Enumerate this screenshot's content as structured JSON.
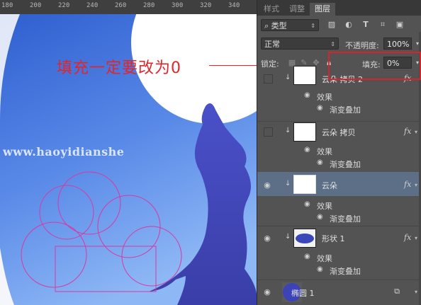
{
  "ruler": {
    "labels": [
      "180",
      "200",
      "220",
      "240",
      "260",
      "280",
      "300",
      "320",
      "340"
    ]
  },
  "canvas": {
    "watermark": "www.haoyidianshe",
    "annotation": "填充一定要改为0"
  },
  "panel": {
    "tabs": [
      {
        "label": "样式",
        "active": false
      },
      {
        "label": "调整",
        "active": false
      },
      {
        "label": "图层",
        "active": true
      }
    ],
    "filter": {
      "kind_label": "类型",
      "search_icon": "search-icon"
    },
    "blend": {
      "mode": "正常",
      "opacity_label": "不透明度:",
      "opacity_value": "100%"
    },
    "lock": {
      "label": "锁定:",
      "fill_label": "填充:",
      "fill_value": "0%"
    },
    "layers": [
      {
        "name": "云朵 拷贝 2",
        "visible": false,
        "selected": false,
        "fx": "fx",
        "effects_label": "效果",
        "effect": "渐变叠加"
      },
      {
        "name": "云朵 拷贝",
        "visible": false,
        "selected": false,
        "fx": "fx",
        "effects_label": "效果",
        "effect": "渐变叠加"
      },
      {
        "name": "云朵",
        "visible": true,
        "selected": true,
        "fx": "fx",
        "effects_label": "效果",
        "effect": "渐变叠加"
      },
      {
        "name": "形状 1",
        "visible": true,
        "selected": false,
        "fx": "fx",
        "effects_label": "效果",
        "effect": "渐变叠加"
      },
      {
        "name": "椭圆 1",
        "visible": true,
        "selected": false,
        "fx": "",
        "effects_label": "",
        "effect": ""
      }
    ]
  },
  "colors": {
    "annotation_red": "#e0262b",
    "panel_bg": "#535353",
    "selected_layer": "#5c6f87",
    "sky_blue": "#3f6fd8"
  }
}
